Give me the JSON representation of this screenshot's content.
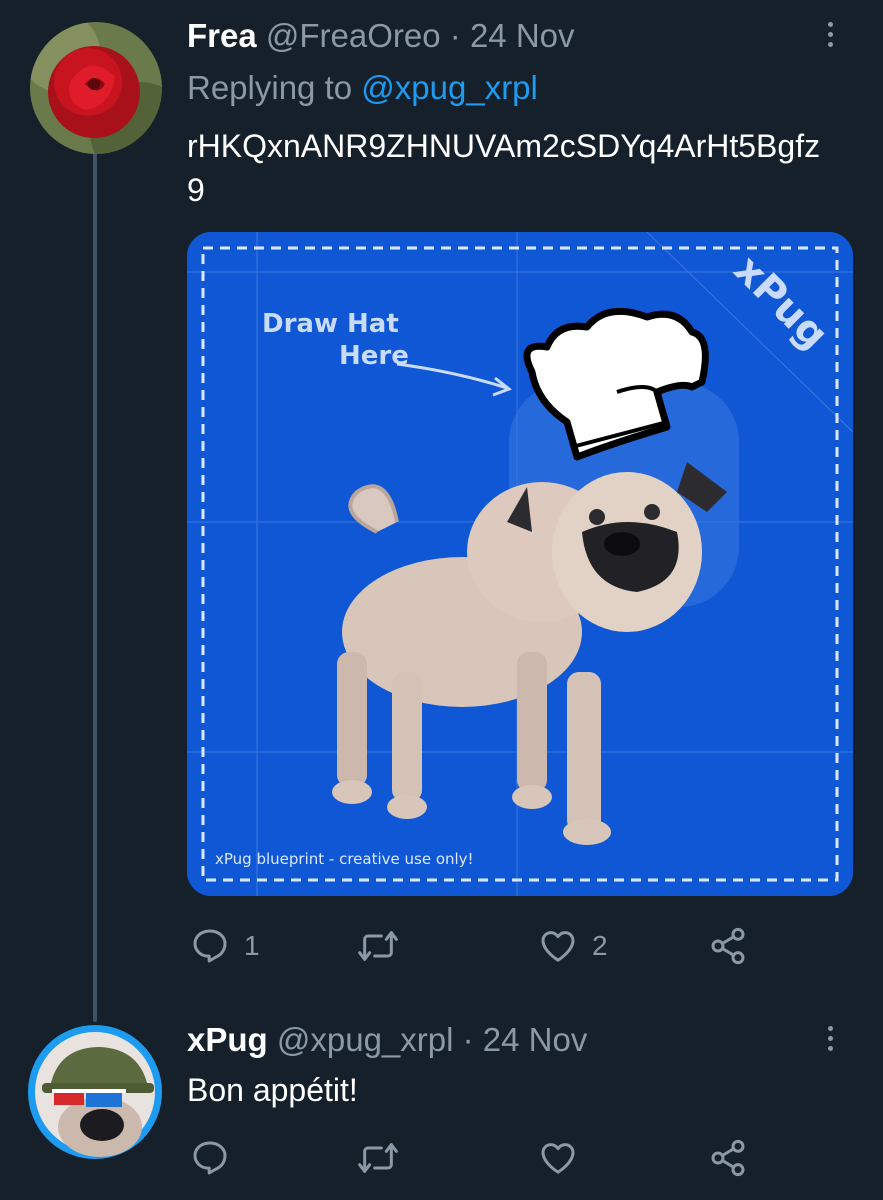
{
  "tweet1": {
    "name": "Frea",
    "handle": "@FreaOreo",
    "separator": "·",
    "date": "24 Nov",
    "replying_prefix": "Replying to",
    "replying_to": "@xpug_xrpl",
    "text": "rHKQxnANR9ZHNUVAm2cSDYq4ArHt5Bgfz9",
    "media": {
      "label_line1": "Draw Hat",
      "label_line2": "Here",
      "brand": "xPug",
      "footer": "xPug blueprint - creative use only!"
    },
    "reply_count": "1",
    "retweet_count": "",
    "like_count": "2"
  },
  "tweet2": {
    "name": "xPug",
    "handle": "@xpug_xrpl",
    "separator": "·",
    "date": "24 Nov",
    "text": "Bon appétit!"
  },
  "colors": {
    "background": "#15202b",
    "muted": "#8b98a5",
    "link": "#1d9bf0",
    "media_blue": "#0f57d4"
  },
  "icons": [
    "reply-icon",
    "retweet-icon",
    "like-icon",
    "share-icon",
    "more-icon"
  ]
}
